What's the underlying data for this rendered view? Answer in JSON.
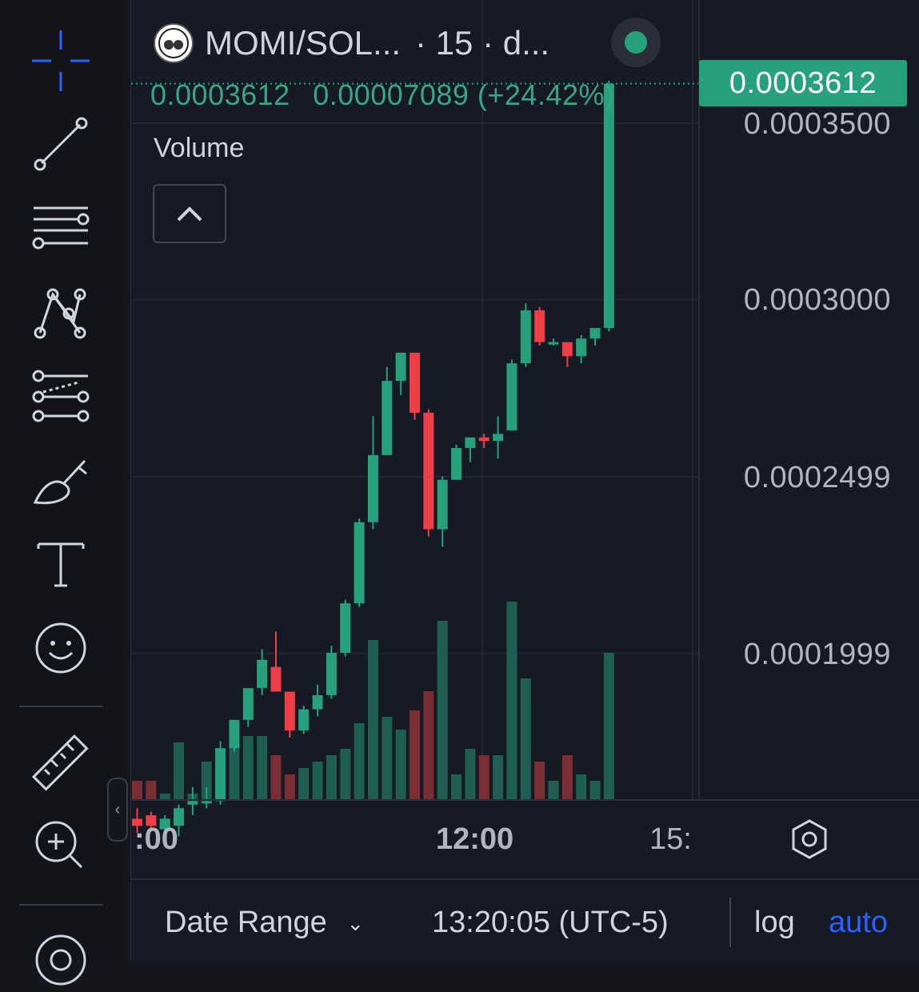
{
  "header": {
    "symbol": "MOMI/SOL...",
    "interval_text": "· 15 · d..."
  },
  "ohlc": {
    "price": "0.0003612",
    "change": "0.00007089 (+24.42%)"
  },
  "volume_label": "Volume",
  "last_price_tag": "0.0003612",
  "price_axis": [
    "0.0003500",
    "0.0003000",
    "0.0002499",
    "0.0001999"
  ],
  "time_axis": [
    ":00",
    "12:00",
    "15:"
  ],
  "bottom_bar": {
    "date_range": "Date Range",
    "clock": "13:20:05 (UTC-5)",
    "log": "log",
    "auto": "auto"
  },
  "colors": {
    "up": "#26a17b",
    "down": "#ef3e45",
    "up_volume": "#1f5e50",
    "down_volume": "#7a2f35",
    "accent": "#2962ff"
  },
  "toolbar_icons": [
    "crosshair-icon",
    "trend-line-icon",
    "horizontal-lines-icon",
    "pattern-icon",
    "fib-icon",
    "brush-icon",
    "text-icon",
    "emoji-icon",
    "ruler-icon",
    "zoom-in-icon",
    "magnet-icon"
  ],
  "chart_data": {
    "type": "candlestick",
    "title": "MOMI/SOL",
    "interval": "15",
    "candles": [
      {
        "o": 0.000153,
        "h": 0.000156,
        "l": 0.000149,
        "c": 0.000151
      },
      {
        "o": 0.000154,
        "h": 0.000155,
        "l": 0.00015,
        "c": 0.000151
      },
      {
        "o": 0.00015,
        "h": 0.000154,
        "l": 0.000149,
        "c": 0.000153
      },
      {
        "o": 0.000151,
        "h": 0.000157,
        "l": 0.000148,
        "c": 0.000156
      },
      {
        "o": 0.000157,
        "h": 0.000162,
        "l": 0.000154,
        "c": 0.000158
      },
      {
        "o": 0.000158,
        "h": 0.000162,
        "l": 0.000156,
        "c": 0.000158
      },
      {
        "o": 0.000158,
        "h": 0.000175,
        "l": 0.000157,
        "c": 0.000173
      },
      {
        "o": 0.000173,
        "h": 0.000181,
        "l": 0.000172,
        "c": 0.000181
      },
      {
        "o": 0.000181,
        "h": 0.00019,
        "l": 0.000179,
        "c": 0.00019
      },
      {
        "o": 0.00019,
        "h": 0.000201,
        "l": 0.000188,
        "c": 0.000198
      },
      {
        "o": 0.000196,
        "h": 0.000206,
        "l": 0.000191,
        "c": 0.000189
      },
      {
        "o": 0.000189,
        "h": 0.000189,
        "l": 0.000176,
        "c": 0.000178
      },
      {
        "o": 0.000178,
        "h": 0.000185,
        "l": 0.000177,
        "c": 0.000184
      },
      {
        "o": 0.000184,
        "h": 0.000191,
        "l": 0.000182,
        "c": 0.000188
      },
      {
        "o": 0.000188,
        "h": 0.000202,
        "l": 0.000187,
        "c": 0.0002
      },
      {
        "o": 0.0002,
        "h": 0.000215,
        "l": 0.000199,
        "c": 0.000214
      },
      {
        "o": 0.000214,
        "h": 0.000238,
        "l": 0.000213,
        "c": 0.000237
      },
      {
        "o": 0.000237,
        "h": 0.000267,
        "l": 0.000235,
        "c": 0.000256
      },
      {
        "o": 0.000256,
        "h": 0.000281,
        "l": 0.000256,
        "c": 0.000277
      },
      {
        "o": 0.000277,
        "h": 0.000285,
        "l": 0.000273,
        "c": 0.000285
      },
      {
        "o": 0.000285,
        "h": 0.000285,
        "l": 0.000266,
        "c": 0.000268
      },
      {
        "o": 0.000268,
        "h": 0.000269,
        "l": 0.000233,
        "c": 0.000235
      },
      {
        "o": 0.000235,
        "h": 0.00025,
        "l": 0.00023,
        "c": 0.000249
      },
      {
        "o": 0.000249,
        "h": 0.000259,
        "l": 0.000249,
        "c": 0.000258
      },
      {
        "o": 0.000258,
        "h": 0.000261,
        "l": 0.000254,
        "c": 0.000261
      },
      {
        "o": 0.000261,
        "h": 0.000262,
        "l": 0.000258,
        "c": 0.00026
      },
      {
        "o": 0.00026,
        "h": 0.000267,
        "l": 0.000255,
        "c": 0.000262
      },
      {
        "o": 0.000263,
        "h": 0.000283,
        "l": 0.000263,
        "c": 0.000282
      },
      {
        "o": 0.000282,
        "h": 0.000299,
        "l": 0.000281,
        "c": 0.000297
      },
      {
        "o": 0.000297,
        "h": 0.000298,
        "l": 0.000287,
        "c": 0.000288
      },
      {
        "o": 0.000288,
        "h": 0.000289,
        "l": 0.000287,
        "c": 0.000288
      },
      {
        "o": 0.000288,
        "h": 0.000288,
        "l": 0.000281,
        "c": 0.000284
      },
      {
        "o": 0.000284,
        "h": 0.00029,
        "l": 0.000282,
        "c": 0.000289
      },
      {
        "o": 0.000289,
        "h": 0.000292,
        "l": 0.000287,
        "c": 0.000292
      },
      {
        "o": 0.000292,
        "h": 0.000362,
        "l": 0.000291,
        "c": 0.0003612
      }
    ],
    "volume": [
      3,
      3,
      1,
      9,
      1,
      6,
      3,
      9,
      10,
      10,
      7,
      4,
      5,
      6,
      7,
      8,
      12,
      25,
      13,
      11,
      14,
      17,
      28,
      4,
      8,
      7,
      7,
      31,
      19,
      6,
      3,
      7,
      4,
      3,
      23
    ],
    "y_ticks": [
      0.00035,
      0.0003,
      0.0002499,
      0.0001999
    ],
    "ylim": [
      0.000145,
      0.000372
    ],
    "x_ticks": [
      ":00",
      "12:00",
      "15:"
    ]
  }
}
